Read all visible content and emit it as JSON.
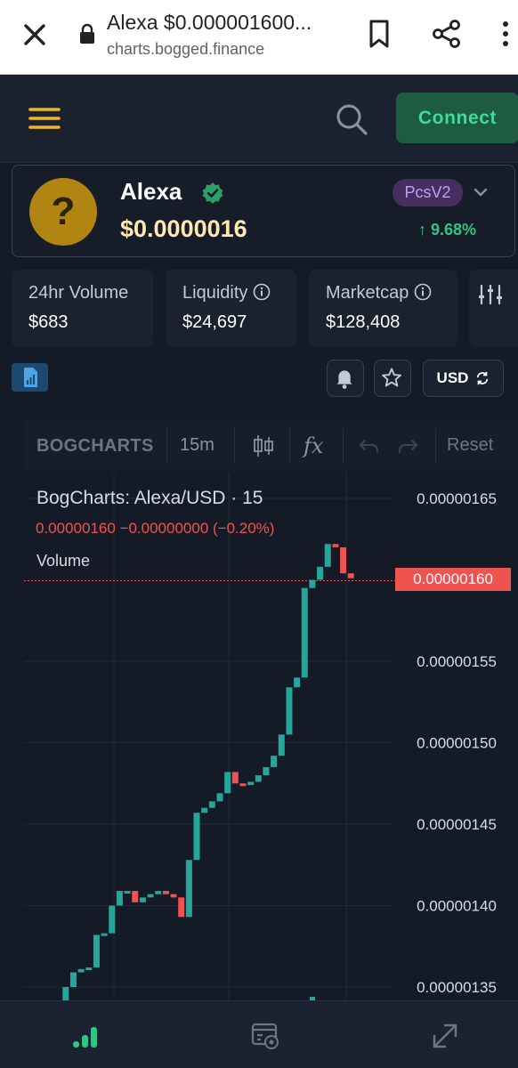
{
  "browser": {
    "title": "Alexa $0.00000160​0...",
    "url": "charts.bogged.finance"
  },
  "header": {
    "connect_label": "Connect"
  },
  "token": {
    "logo_glyph": "?",
    "name": "Alexa",
    "price": "$0.0000016",
    "exchange": "PcsV2",
    "change": "9.68%",
    "change_color": "#36c283"
  },
  "stats": [
    {
      "label": "24hr Volume",
      "value": "$683"
    },
    {
      "label": "Liquidity",
      "value": "$24,697"
    },
    {
      "label": "Marketcap",
      "value": "$128,408"
    }
  ],
  "controls": {
    "currency": "USD"
  },
  "toolbar": {
    "brand": "BOGCHARTS",
    "interval": "15m",
    "fx_label": "fx",
    "reset_label": "Reset"
  },
  "chart_data": {
    "type": "candlestick",
    "title": "BogCharts: Alexa/USD · 15",
    "legend_ohlc": "0.00000160  −0.00000000 (−0.20%)",
    "legend_volume": "Volume",
    "y_ticks": [
      "0.00000165",
      "0.00000155",
      "0.00000150",
      "0.00000145",
      "0.00000140",
      "0.00000135"
    ],
    "y_tick_values": [
      1.65e-06,
      1.55e-06,
      1.5e-06,
      1.45e-06,
      1.4e-06,
      1.35e-06
    ],
    "current_price_label": "0.00000160",
    "current_price": 1.6e-06,
    "up_color": "#26a69a",
    "down_color": "#ef5350",
    "candles": [
      {
        "o": 1.335e-06,
        "c": 1.325e-06
      },
      {
        "o": 1.323e-06,
        "c": 1.327e-06
      },
      {
        "o": 1.327e-06,
        "c": 1.33e-06
      },
      {
        "o": 1.33e-06,
        "c": 1.333e-06
      },
      {
        "o": 1.333e-06,
        "c": 1.338e-06
      },
      {
        "o": 1.338e-06,
        "c": 1.35e-06
      },
      {
        "o": 1.35e-06,
        "c": 1.359e-06
      },
      {
        "o": 1.359e-06,
        "c": 1.361e-06
      },
      {
        "o": 1.361e-06,
        "c": 1.362e-06
      },
      {
        "o": 1.362e-06,
        "c": 1.382e-06
      },
      {
        "o": 1.382e-06,
        "c": 1.383e-06
      },
      {
        "o": 1.383e-06,
        "c": 1.4e-06
      },
      {
        "o": 1.4e-06,
        "c": 1.409e-06
      },
      {
        "o": 1.409e-06,
        "c": 1.409e-06
      },
      {
        "o": 1.409e-06,
        "c": 1.402e-06
      },
      {
        "o": 1.402e-06,
        "c": 1.405e-06
      },
      {
        "o": 1.405e-06,
        "c": 1.407e-06
      },
      {
        "o": 1.407e-06,
        "c": 1.409e-06
      },
      {
        "o": 1.409e-06,
        "c": 1.407e-06
      },
      {
        "o": 1.407e-06,
        "c": 1.405e-06
      },
      {
        "o": 1.405e-06,
        "c": 1.393e-06
      },
      {
        "o": 1.393e-06,
        "c": 1.428e-06
      },
      {
        "o": 1.428e-06,
        "c": 1.457e-06
      },
      {
        "o": 1.457e-06,
        "c": 1.46e-06
      },
      {
        "o": 1.46e-06,
        "c": 1.464e-06
      },
      {
        "o": 1.464e-06,
        "c": 1.469e-06
      },
      {
        "o": 1.469e-06,
        "c": 1.482e-06
      },
      {
        "o": 1.482e-06,
        "c": 1.475e-06
      },
      {
        "o": 1.475e-06,
        "c": 1.474e-06
      },
      {
        "o": 1.474e-06,
        "c": 1.476e-06
      },
      {
        "o": 1.476e-06,
        "c": 1.48e-06
      },
      {
        "o": 1.48e-06,
        "c": 1.485e-06
      },
      {
        "o": 1.485e-06,
        "c": 1.492e-06
      },
      {
        "o": 1.492e-06,
        "c": 1.505e-06
      },
      {
        "o": 1.505e-06,
        "c": 1.534e-06
      },
      {
        "o": 1.534e-06,
        "c": 1.54e-06
      },
      {
        "o": 1.54e-06,
        "c": 1.595e-06
      },
      {
        "o": 1.595e-06,
        "c": 1.6e-06
      },
      {
        "o": 1.6e-06,
        "c": 1.608e-06
      },
      {
        "o": 1.608e-06,
        "c": 1.622e-06
      },
      {
        "o": 1.622e-06,
        "c": 1.62e-06
      },
      {
        "o": 1.62e-06,
        "c": 1.604e-06
      },
      {
        "o": 1.604e-06,
        "c": 1.601e-06
      }
    ]
  }
}
